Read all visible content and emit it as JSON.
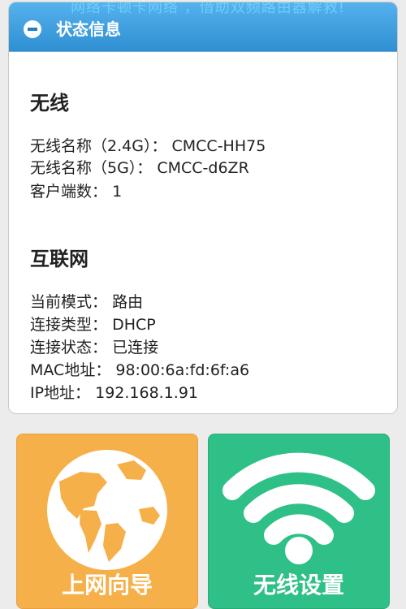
{
  "header": {
    "watermark": "网络卡顿卡网络 ，借助双频路由器解救!",
    "title": "状态信息",
    "collapse_icon": "minus-circle-icon"
  },
  "wireless": {
    "title": "无线",
    "ssid_24_label": "无线名称（2.4G）：",
    "ssid_24_value": "CMCC-HH75",
    "ssid_5_label": "无线名称（5G）：",
    "ssid_5_value": "CMCC-d6ZR",
    "clients_label": "客户端数：",
    "clients_value": "1"
  },
  "internet": {
    "title": "互联网",
    "mode_label": "当前模式：",
    "mode_value": "路由",
    "conn_type_label": "连接类型：",
    "conn_type_value": "DHCP",
    "conn_status_label": "连接状态：",
    "conn_status_value": "已连接",
    "mac_label": "MAC地址：",
    "mac_value": "98:00:6a:fd:6f:a6",
    "ip_label": "IP地址：",
    "ip_value": "192.168.1.91"
  },
  "tiles": {
    "wizard_label": "上网向导",
    "wizard_icon": "globe-icon",
    "wizard_color": "#f6b04a",
    "wifi_label": "无线设置",
    "wifi_icon": "wifi-icon",
    "wifi_color": "#2fc087"
  }
}
